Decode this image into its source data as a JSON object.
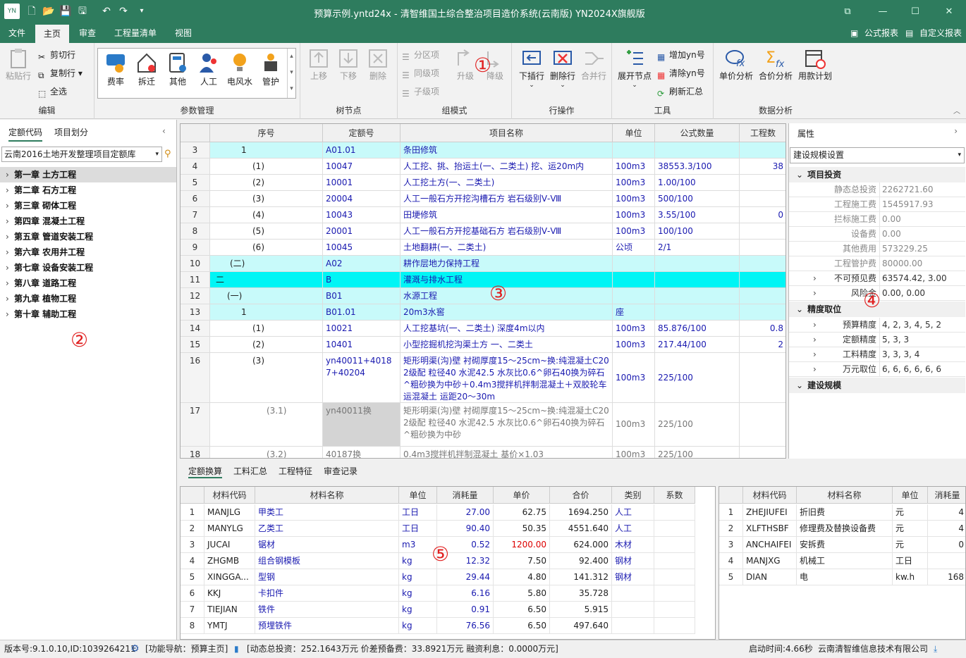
{
  "window": {
    "title": "预算示例.yntd24x - 清智维国土综合整治项目造价系统(云南版) YN2024X旗舰版"
  },
  "menu": {
    "file": "文件",
    "home": "主页",
    "review": "审查",
    "quantities": "工程量清单",
    "view": "视图",
    "formula_report": "公式报表",
    "custom_report": "自定义报表"
  },
  "ribbon": {
    "edit": {
      "group": "编辑",
      "paste": "粘贴行",
      "cut": "剪切行",
      "copy": "复制行",
      "select_all": "全选"
    },
    "param": {
      "group": "参数管理",
      "items": [
        "费率",
        "拆迁",
        "其他",
        "人工",
        "电风水",
        "管护"
      ]
    },
    "tree": {
      "group": "树节点",
      "up": "上移",
      "down": "下移",
      "delete": "删除"
    },
    "group_mode": {
      "group": "组模式",
      "section": "分区项",
      "same_level": "同级项",
      "child": "子级项",
      "promote": "升级",
      "demote": "降级"
    },
    "row_ops": {
      "group": "行操作",
      "insert_below": "下插行",
      "delete_row": "删除行",
      "merge_row": "合并行"
    },
    "tools": {
      "group": "工具",
      "expand": "展开节点",
      "add_yn": "增加yn号",
      "clear_yn": "清除yn号",
      "refresh": "刷新汇总"
    },
    "analysis": {
      "group": "数据分析",
      "unit_price": "单价分析",
      "total_price": "合价分析",
      "schedule": "用款计划"
    }
  },
  "left": {
    "tab1": "定额代码",
    "tab2": "项目划分",
    "library": "云南2016土地开发整理项目定额库",
    "chapters": [
      "第一章 土方工程",
      "第二章 石方工程",
      "第三章 砌体工程",
      "第四章 混凝土工程",
      "第五章 管道安装工程",
      "第六章 农用井工程",
      "第七章 设备安装工程",
      "第八章 道路工程",
      "第九章 植物工程",
      "第十章 辅助工程"
    ]
  },
  "grid": {
    "headers": [
      "序号",
      "定额号",
      "项目名称",
      "单位",
      "公式数量",
      "工程数"
    ],
    "rows": [
      {
        "n": "3",
        "seq": "1",
        "code": "A01.01",
        "name": "条田修筑",
        "unit": "",
        "qty": "",
        "extra": ""
      },
      {
        "n": "4",
        "seq": "(1)",
        "code": "10047",
        "name": "人工挖、挑、抬运土(一、二类土) 挖、运20m内",
        "unit": "100m3",
        "qty": "38553.3/100",
        "extra": "38"
      },
      {
        "n": "5",
        "seq": "(2)",
        "code": "10001",
        "name": "人工挖土方(一、二类土)",
        "unit": "100m3",
        "qty": "1.00/100",
        "extra": ""
      },
      {
        "n": "6",
        "seq": "(3)",
        "code": "20004",
        "name": "人工一般石方开挖沟槽石方 岩石级别Ⅴ-Ⅷ",
        "unit": "100m3",
        "qty": "500/100",
        "extra": ""
      },
      {
        "n": "7",
        "seq": "(4)",
        "code": "10043",
        "name": "田埂修筑",
        "unit": "100m3",
        "qty": "3.55/100",
        "extra": "0"
      },
      {
        "n": "8",
        "seq": "(5)",
        "code": "20001",
        "name": "人工一般石方开挖基础石方 岩石级别Ⅴ-Ⅷ",
        "unit": "100m3",
        "qty": "100/100",
        "extra": ""
      },
      {
        "n": "9",
        "seq": "(6)",
        "code": "10045",
        "name": "土地翻耕(一、二类土)",
        "unit": "公顷",
        "qty": "2/1",
        "extra": ""
      },
      {
        "n": "10",
        "seq": "(二)",
        "code": "A02",
        "name": "耕作层地力保持工程",
        "unit": "",
        "qty": "",
        "extra": ""
      },
      {
        "n": "11",
        "seq": "二",
        "code": "B",
        "name": "灌溉与排水工程",
        "unit": "",
        "qty": "",
        "extra": ""
      },
      {
        "n": "12",
        "seq": "(一)",
        "code": "B01",
        "name": "水源工程",
        "unit": "",
        "qty": "",
        "extra": ""
      },
      {
        "n": "13",
        "seq": "1",
        "code": "B01.01",
        "name": "20m3水窖",
        "unit": "座",
        "qty": "",
        "extra": ""
      },
      {
        "n": "14",
        "seq": "(1)",
        "code": "10021",
        "name": "人工挖基坑(一、二类土) 深度4m以内",
        "unit": "100m3",
        "qty": "85.876/100",
        "extra": "0.8"
      },
      {
        "n": "15",
        "seq": "(2)",
        "code": "10401",
        "name": "小型挖掘机挖沟渠土方 一、二类土",
        "unit": "100m3",
        "qty": "217.44/100",
        "extra": "2"
      },
      {
        "n": "16",
        "seq": "(3)",
        "code": "yn40011+40187+40204",
        "name": "矩形明渠(沟)壁 衬砌厚度15～25cm~换:纯混凝土C20 2级配 粒径40 水泥42.5 水灰比0.6^卵石40换为碎石^粗砂换为中砂＋0.4m3搅拌机拌制混凝土＋双胶轮车运混凝土 运距20～30m",
        "unit": "100m3",
        "qty": "225/100",
        "extra": ""
      },
      {
        "n": "17",
        "seq": "(3.1)",
        "code": "yn40011换",
        "name": "矩形明渠(沟)壁 衬砌厚度15～25cm~换:纯混凝土C20 2级配 粒径40 水泥42.5 水灰比0.6^卵石40换为碎石^粗砂换为中砂",
        "unit": "100m3",
        "qty": "225/100",
        "extra": ""
      },
      {
        "n": "18",
        "seq": "(3.2)",
        "code": "40187换",
        "name": "0.4m3搅拌机拌制混凝土 基价×1.03",
        "unit": "100m3",
        "qty": "225/100",
        "extra": ""
      }
    ]
  },
  "props": {
    "title": "属性",
    "dropdown": "建设规模设置",
    "sec1": "项目投资",
    "invest": [
      {
        "k": "静态总投资",
        "v": "2262721.60"
      },
      {
        "k": "工程施工费",
        "v": "1545917.93"
      },
      {
        "k": "拦标施工费",
        "v": "0.00"
      },
      {
        "k": "设备费",
        "v": "0.00"
      },
      {
        "k": "其他费用",
        "v": "573229.25"
      },
      {
        "k": "工程管护费",
        "v": "80000.00"
      },
      {
        "k": "不可预见费",
        "v": "63574.42, 3.00"
      },
      {
        "k": "风险金",
        "v": "0.00, 0.00"
      }
    ],
    "sec2": "精度取位",
    "precision": [
      {
        "k": "预算精度",
        "v": "4, 2, 3, 4, 5, 2"
      },
      {
        "k": "定额精度",
        "v": "5, 3, 3"
      },
      {
        "k": "工料精度",
        "v": "3, 3, 3, 4"
      },
      {
        "k": "万元取位",
        "v": "6, 6, 6, 6, 6, 6"
      }
    ],
    "sec3": "建设规模"
  },
  "bottom": {
    "tabs": [
      "定额换算",
      "工料汇总",
      "工程特征",
      "审查记录"
    ],
    "t1_headers": [
      "材料代码",
      "材料名称",
      "单位",
      "消耗量",
      "单价",
      "合价",
      "类别",
      "系数"
    ],
    "t1_rows": [
      {
        "n": "1",
        "code": "MANJLG",
        "name": "甲类工",
        "unit": "工日",
        "qty": "27.00",
        "price": "62.75",
        "total": "1694.250",
        "type": "人工"
      },
      {
        "n": "2",
        "code": "MANYLG",
        "name": "乙类工",
        "unit": "工日",
        "qty": "90.40",
        "price": "50.35",
        "total": "4551.640",
        "type": "人工"
      },
      {
        "n": "3",
        "code": "JUCAI",
        "name": "锯材",
        "unit": "m3",
        "qty": "0.52",
        "price": "1200.00",
        "total": "624.000",
        "type": "木材"
      },
      {
        "n": "4",
        "code": "ZHGMB",
        "name": "组合钢模板",
        "unit": "kg",
        "qty": "12.32",
        "price": "7.50",
        "total": "92.400",
        "type": "钢材"
      },
      {
        "n": "5",
        "code": "XINGGA...",
        "name": "型钢",
        "unit": "kg",
        "qty": "29.44",
        "price": "4.80",
        "total": "141.312",
        "type": "钢材"
      },
      {
        "n": "6",
        "code": "KKJ",
        "name": "卡扣件",
        "unit": "kg",
        "qty": "6.16",
        "price": "5.80",
        "total": "35.728",
        "type": ""
      },
      {
        "n": "7",
        "code": "TIEJIAN",
        "name": "铁件",
        "unit": "kg",
        "qty": "0.91",
        "price": "6.50",
        "total": "5.915",
        "type": ""
      },
      {
        "n": "8",
        "code": "YMTJ",
        "name": "预埋铁件",
        "unit": "kg",
        "qty": "76.56",
        "price": "6.50",
        "total": "497.640",
        "type": ""
      }
    ],
    "t2_headers": [
      "材料代码",
      "材料名称",
      "单位",
      "消耗量"
    ],
    "t2_rows": [
      {
        "n": "1",
        "code": "ZHEJIUFEI",
        "name": "折旧费",
        "unit": "元",
        "qty": "4"
      },
      {
        "n": "2",
        "code": "XLFTHSBF",
        "name": "修理费及替换设备费",
        "unit": "元",
        "qty": "4"
      },
      {
        "n": "3",
        "code": "ANCHAIFEI",
        "name": "安拆费",
        "unit": "元",
        "qty": "0"
      },
      {
        "n": "4",
        "code": "MANJXG",
        "name": "机械工",
        "unit": "工日",
        "qty": ""
      },
      {
        "n": "5",
        "code": "DIAN",
        "name": "电",
        "unit": "kw.h",
        "qty": "168"
      }
    ]
  },
  "status": {
    "version": "版本号:9.1.0.10,ID:1039264211",
    "nav": "[功能导航：预算主页]",
    "summary": "[动态总投资：252.1643万元 价差预备费：33.8921万元 融资利息：0.0000万元]",
    "startup": "启动时间:4.66秒",
    "company": "云南清智维信息技术有限公司"
  },
  "markers": [
    "①",
    "②",
    "③",
    "④",
    "⑤"
  ],
  "colors": {
    "brand": "#2e7c5e",
    "row_cyan": "#c8fafa",
    "row_cyan_strong": "#00f5f5",
    "link_blue": "#1a1ab0",
    "marker_red": "#e02020"
  }
}
